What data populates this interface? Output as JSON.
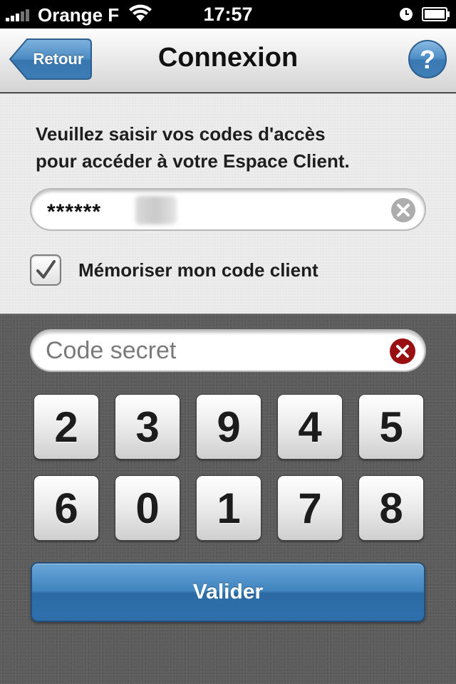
{
  "status_bar": {
    "carrier": "Orange F",
    "time": "17:57"
  },
  "nav": {
    "back_label": "Retour",
    "title": "Connexion",
    "help_label": "?"
  },
  "login": {
    "instructions_line1": "Veuillez saisir vos codes d'accès",
    "instructions_line2": "pour accéder à votre Espace Client.",
    "client_code_value": "******",
    "remember_label": "Mémoriser mon code client",
    "remember_checked": true,
    "secret_placeholder": "Code secret"
  },
  "keypad": {
    "row1": [
      "2",
      "3",
      "9",
      "4",
      "5"
    ],
    "row2": [
      "6",
      "0",
      "1",
      "7",
      "8"
    ]
  },
  "validate_label": "Valider",
  "colors": {
    "nav_button": "#3f84bf",
    "validate_button": "#3f84bf",
    "clear_red": "#9a0f12"
  }
}
